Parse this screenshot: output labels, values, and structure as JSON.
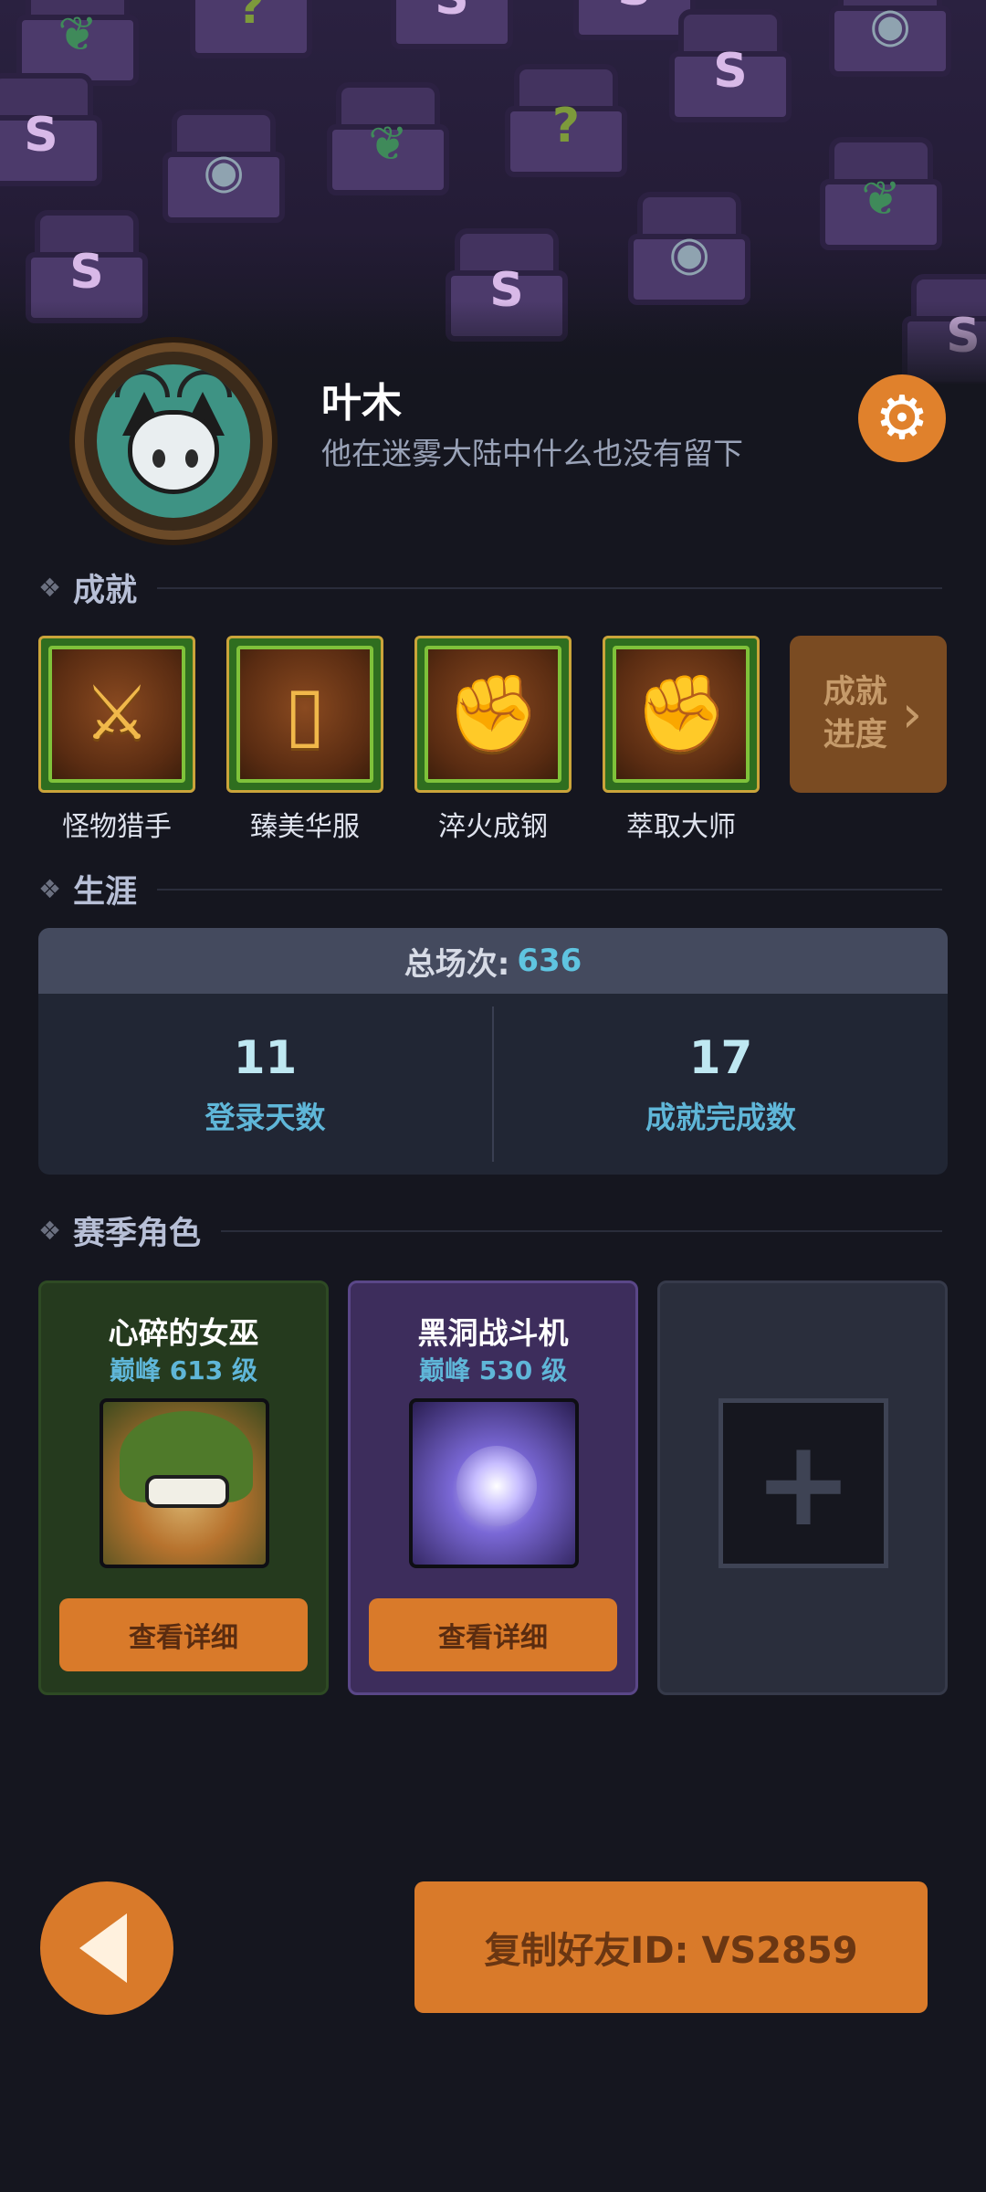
{
  "theme": {
    "accent": "#d97a2a",
    "stat_color": "#5fb6d8",
    "background": "#15161f"
  },
  "profile": {
    "name": "叶木",
    "bio": "他在迷雾大陆中什么也没有留下",
    "settings_icon": "gear-icon"
  },
  "achievements": {
    "title": "成就",
    "items": [
      {
        "label": "怪物猎手",
        "icon": "sword-badge-icon",
        "glyph": "⚔"
      },
      {
        "label": "臻美华服",
        "icon": "armor-badge-icon",
        "glyph": "▯"
      },
      {
        "label": "淬火成钢",
        "icon": "fist-badge-icon",
        "glyph": "✊"
      },
      {
        "label": "萃取大师",
        "icon": "fist-badge-icon",
        "glyph": "✊"
      }
    ],
    "progress_button": "成就进度"
  },
  "career": {
    "title": "生涯",
    "total_label": "总场次:",
    "total_value": "636",
    "stats": [
      {
        "value": "11",
        "label": "登录天数"
      },
      {
        "value": "17",
        "label": "成就完成数"
      }
    ]
  },
  "season": {
    "title": "赛季角色",
    "characters": [
      {
        "name": "心碎的女巫",
        "level": "巅峰 613 级",
        "button": "查看详细"
      },
      {
        "name": "黑洞战斗机",
        "level": "巅峰 530 级",
        "button": "查看详细"
      }
    ],
    "empty_slot_icon": "plus-icon"
  },
  "footer": {
    "back_icon": "back-arrow-icon",
    "copy_button": "复制好友ID: VS2859"
  }
}
